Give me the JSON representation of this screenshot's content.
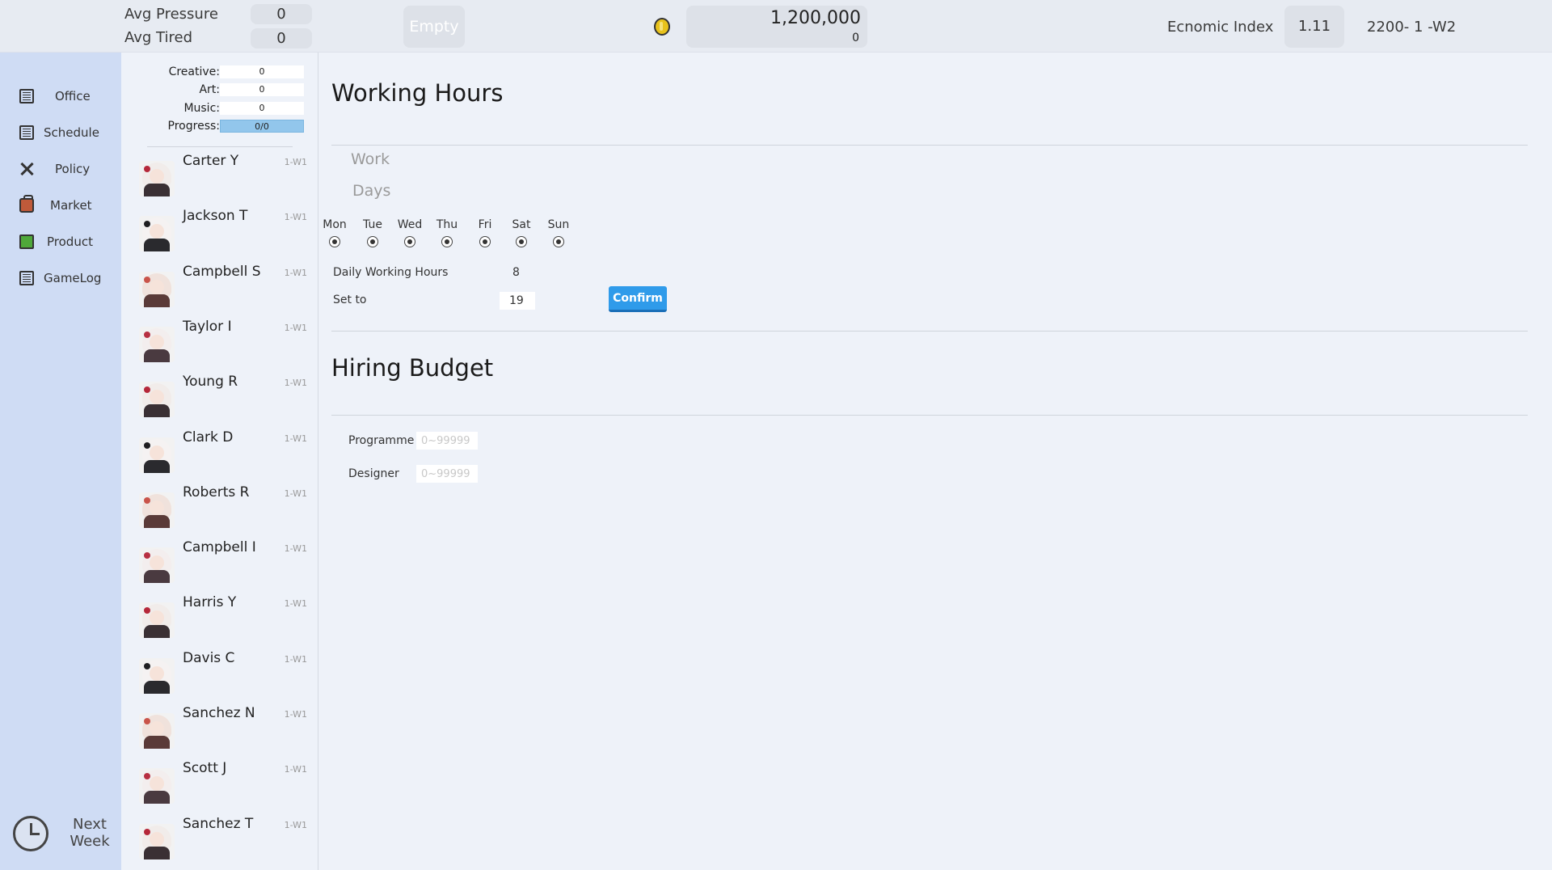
{
  "topbar": {
    "avg_pressure_label": "Avg Pressure",
    "avg_pressure_value": "0",
    "avg_tired_label": "Avg Tired",
    "avg_tired_value": "0",
    "empty_label": "Empty",
    "coin_icon": "coin-icon",
    "money": "1,200,000",
    "money_sub": "0",
    "economic_index_label": "Ecnomic Index",
    "economic_index_value": "1.11",
    "date": "2200- 1 -W2"
  },
  "nav": {
    "items": [
      {
        "label": "Office",
        "icon": "grid-icon"
      },
      {
        "label": "Schedule",
        "icon": "grid-icon"
      },
      {
        "label": "Policy",
        "icon": "tools-icon"
      },
      {
        "label": "Market",
        "icon": "bag-icon"
      },
      {
        "label": "Product",
        "icon": "box-icon"
      },
      {
        "label": "GameLog",
        "icon": "grid-icon"
      }
    ],
    "next_week": "Next Week"
  },
  "stats": {
    "creative_label": "Creative:",
    "creative_value": "0",
    "art_label": "Art:",
    "art_value": "0",
    "music_label": "Music:",
    "music_value": "0",
    "progress_label": "Progress:",
    "progress_value": "0/0"
  },
  "employees": [
    {
      "name": "Carter Y",
      "tag": "1-W1"
    },
    {
      "name": "Jackson T",
      "tag": "1-W1"
    },
    {
      "name": "Campbell S",
      "tag": "1-W1"
    },
    {
      "name": "Taylor I",
      "tag": "1-W1"
    },
    {
      "name": "Young R",
      "tag": "1-W1"
    },
    {
      "name": "Clark D",
      "tag": "1-W1"
    },
    {
      "name": "Roberts R",
      "tag": "1-W1"
    },
    {
      "name": "Campbell I",
      "tag": "1-W1"
    },
    {
      "name": "Harris Y",
      "tag": "1-W1"
    },
    {
      "name": "Davis C",
      "tag": "1-W1"
    },
    {
      "name": "Sanchez N",
      "tag": "1-W1"
    },
    {
      "name": "Scott J",
      "tag": "1-W1"
    },
    {
      "name": "Sanchez T",
      "tag": "1-W1"
    }
  ],
  "working_hours": {
    "title": "Working Hours",
    "work_label": "Work",
    "days_label": "Days",
    "days": [
      "Mon",
      "Tue",
      "Wed",
      "Thu",
      "Fri",
      "Sat",
      "Sun"
    ],
    "daily_label": "Daily Working Hours",
    "daily_value": "8",
    "set_to_label": "Set to",
    "set_to_value": "19",
    "confirm_label": "Confirm"
  },
  "hiring_budget": {
    "title": "Hiring Budget",
    "programme_label": "Programme",
    "programme_placeholder": "0~99999",
    "designer_label": "Designer",
    "designer_placeholder": "0~99999"
  }
}
